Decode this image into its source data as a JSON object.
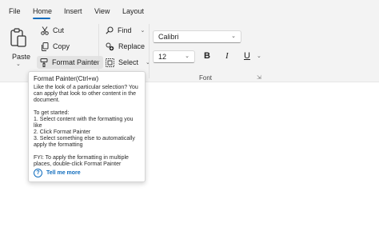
{
  "menu": {
    "file": "File",
    "home": "Home",
    "insert": "Insert",
    "view": "View",
    "layout": "Layout"
  },
  "clipboard": {
    "paste": "Paste",
    "cut": "Cut",
    "copy": "Copy",
    "format_painter": "Format Painter"
  },
  "editing": {
    "find": "Find",
    "replace": "Replace",
    "select": "Select"
  },
  "font": {
    "family": "Calibri",
    "size": "12",
    "bold": "B",
    "italic": "I",
    "underline": "U",
    "group_label": "Font"
  },
  "tooltip": {
    "title": "Format Painter(Ctrl+w)",
    "description": "Like the look of a particular selection? You can apply that look to other content in the document.",
    "steps_heading": "To get started:",
    "step1": "1. Select content with the formatting you like",
    "step2": "2. Click Format Painter",
    "step3": "3. Select something else to automatically apply the formatting",
    "fyi": "FYI: To apply the formatting in multiple places, double-click Format Painter",
    "tell_me_more": "Tell me more"
  },
  "colors": {
    "accent": "#0f6cbd",
    "ribbon_bg": "#f3f3f3"
  }
}
